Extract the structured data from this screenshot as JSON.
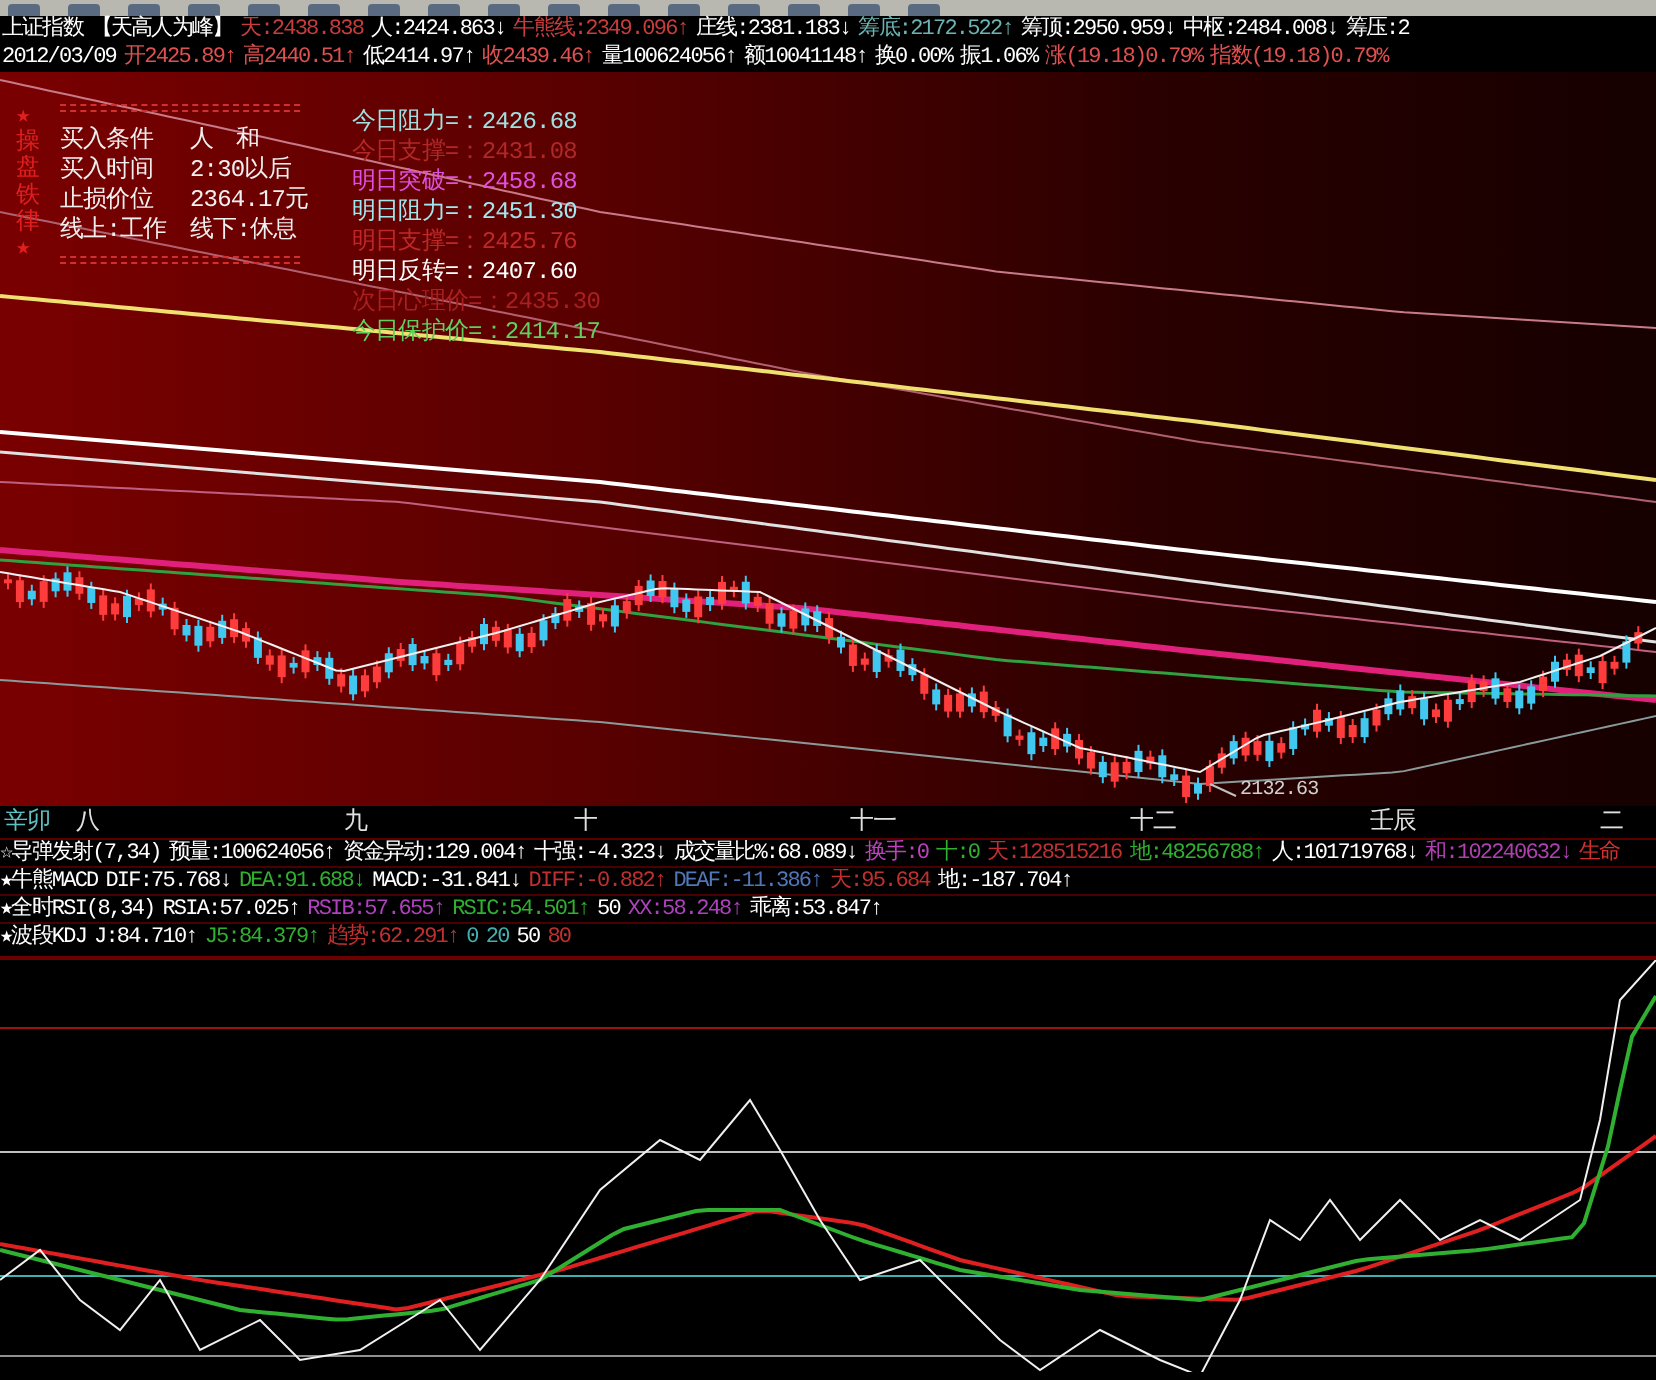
{
  "quote_lines": [
    [
      {
        "text": "上证指数",
        "color": "#ffffff"
      },
      {
        "text": "【天高人为峰】",
        "color": "#ffffff"
      },
      {
        "text": "天:2438.838",
        "color": "#c83c3c"
      },
      {
        "text": "人:2424.863↓",
        "color": "#ffffff"
      },
      {
        "text": "牛熊线:2349.096↑",
        "color": "#c83c3c"
      },
      {
        "text": "庄线:2381.183↓",
        "color": "#ffffff"
      },
      {
        "text": "筹底:2172.522↑",
        "color": "#6cb4b4"
      },
      {
        "text": "筹顶:2950.959↓",
        "color": "#ffffff"
      },
      {
        "text": "中枢:2484.008↓",
        "color": "#ffffff"
      },
      {
        "text": "筹压:2",
        "color": "#ffffff"
      }
    ],
    [
      {
        "text": "2012/03/09",
        "color": "#ffffff"
      },
      {
        "text": "开2425.89↑",
        "color": "#e05050"
      },
      {
        "text": "高2440.51↑",
        "color": "#e05050"
      },
      {
        "text": "低2414.97↑",
        "color": "#ffffff"
      },
      {
        "text": "收2439.46↑",
        "color": "#e05050"
      },
      {
        "text": "量100624056↑",
        "color": "#ffffff"
      },
      {
        "text": "额10041148↑",
        "color": "#ffffff"
      },
      {
        "text": "换0.00%",
        "color": "#ffffff"
      },
      {
        "text": "振1.06%",
        "color": "#ffffff"
      },
      {
        "text": "涨(19.18)0.79%",
        "color": "#e05050"
      },
      {
        "text": "指数(19.18)0.79%",
        "color": "#e05050"
      }
    ]
  ],
  "left_panel": {
    "side_title": "★操盘铁律★",
    "rows": [
      {
        "label": "买入条件",
        "value": "人　和"
      },
      {
        "label": "买入时间",
        "value": "2:30以后"
      },
      {
        "label": "止损价位",
        "value": "2364.17元"
      },
      {
        "label": "线上:工作",
        "value": "线下:休息"
      }
    ]
  },
  "levels": [
    {
      "label": "今日阻力=：",
      "value": "2426.68",
      "color": "#a0e0e0"
    },
    {
      "label": "今日支撑=：",
      "value": "2431.08",
      "color": "#b02828"
    },
    {
      "label": "明日突破=：",
      "value": "2458.68",
      "color": "#e050e0"
    },
    {
      "label": "明日阻力=：",
      "value": "2451.30",
      "color": "#a0e8f0"
    },
    {
      "label": "明日支撑=：",
      "value": "2425.76",
      "color": "#c02828"
    },
    {
      "label": "明日反转=：",
      "value": "2407.60",
      "color": "#ffffff"
    },
    {
      "label": "次日心理价=：",
      "value": "2435.30",
      "color": "#a82020"
    },
    {
      "label": "今日保护价=：",
      "value": "2414.17",
      "color": "#60d060"
    }
  ],
  "low_marker": "2132.63",
  "time_axis": [
    "辛卯",
    "八",
    "九",
    "十",
    "十一",
    "十二",
    "壬辰",
    "二"
  ],
  "indicator_lines": [
    [
      {
        "text": "☆导弹发射(7,34)",
        "color": "#ffffff"
      },
      {
        "text": "预量:100624056↑",
        "color": "#ffffff"
      },
      {
        "text": "资金异动:129.004↑",
        "color": "#ffffff"
      },
      {
        "text": "十强:-4.323↓",
        "color": "#ffffff"
      },
      {
        "text": "成交量比%:68.089↓",
        "color": "#ffffff"
      },
      {
        "text": "换手:0",
        "color": "#c040c0"
      },
      {
        "text": "十:0",
        "color": "#30b030"
      },
      {
        "text": "天:128515216",
        "color": "#c03030"
      },
      {
        "text": "地:48256788↑",
        "color": "#30b030"
      },
      {
        "text": "人:101719768↓",
        "color": "#ffffff"
      },
      {
        "text": "和:102240632↓",
        "color": "#b040b0"
      },
      {
        "text": "生命",
        "color": "#d03030"
      }
    ],
    [
      {
        "text": "★牛熊MACD",
        "color": "#ffffff"
      },
      {
        "text": "DIF:75.768↓",
        "color": "#ffffff"
      },
      {
        "text": "DEA:91.688↓",
        "color": "#30b030"
      },
      {
        "text": "MACD:-31.841↓",
        "color": "#ffffff"
      },
      {
        "text": "DIFF:-0.882↑",
        "color": "#c03030"
      },
      {
        "text": "DEAF:-11.386↑",
        "color": "#5078b8"
      },
      {
        "text": "天:95.684",
        "color": "#c03030"
      },
      {
        "text": "地:-187.704↑",
        "color": "#ffffff"
      }
    ],
    [
      {
        "text": "★全时RSI(8,34)",
        "color": "#ffffff"
      },
      {
        "text": "RSIA:57.025↑",
        "color": "#ffffff"
      },
      {
        "text": "RSIB:57.655↑",
        "color": "#b040c0"
      },
      {
        "text": "RSIC:54.501↑",
        "color": "#30b030"
      },
      {
        "text": "50",
        "color": "#ffffff"
      },
      {
        "text": "XX:58.248↑",
        "color": "#b040c0"
      },
      {
        "text": "乖离:53.847↑",
        "color": "#ffffff"
      }
    ],
    [
      {
        "text": "★波段KDJ",
        "color": "#ffffff"
      },
      {
        "text": "J:84.710↑",
        "color": "#ffffff"
      },
      {
        "text": "J5:84.379↑",
        "color": "#30b030"
      },
      {
        "text": "趋势:62.291↑",
        "color": "#c03030"
      },
      {
        "text": "0",
        "color": "#40b0b0"
      },
      {
        "text": "20",
        "color": "#40b0b0"
      },
      {
        "text": "50",
        "color": "#ffffff"
      },
      {
        "text": "80",
        "color": "#c03030"
      }
    ]
  ]
}
